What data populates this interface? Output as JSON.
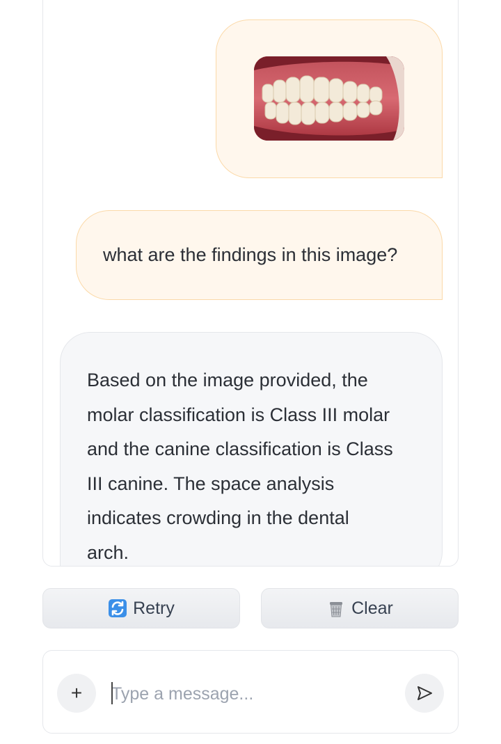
{
  "chat": {
    "messages": [
      {
        "role": "user",
        "type": "image",
        "alt": "intraoral photograph of teeth"
      },
      {
        "role": "user",
        "type": "text",
        "text": "what are the findings in this image?"
      },
      {
        "role": "assistant",
        "type": "text",
        "text": "Based on the image provided, the\nmolar classification is Class III molar\nand the canine classification is Class\nIII canine. The space analysis\nindicates crowding in the dental\narch."
      }
    ]
  },
  "actions": {
    "retry": {
      "icon": "retry-icon",
      "label": "Retry"
    },
    "clear": {
      "icon": "trash-icon",
      "label": "Clear"
    }
  },
  "composer": {
    "add_icon": "plus-icon",
    "placeholder": "Type a message...",
    "value": "",
    "send_icon": "send-icon"
  },
  "colors": {
    "user_bubble_bg": "#fff7ed",
    "user_bubble_border": "#fbd9a8",
    "assistant_bubble_bg": "#f6f7f9",
    "panel_border": "#e5e7eb",
    "retry_icon": "#3b82f6"
  }
}
